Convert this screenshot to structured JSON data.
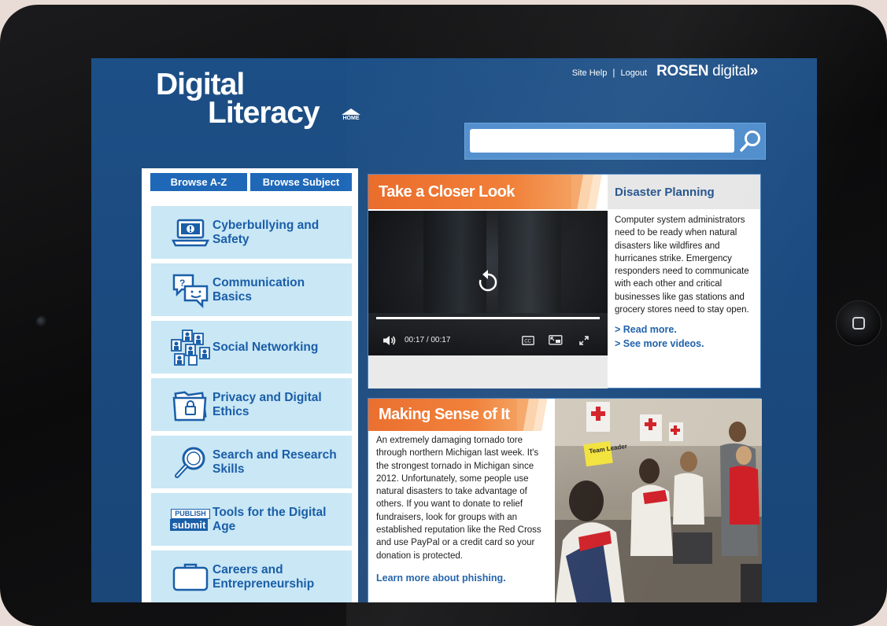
{
  "header": {
    "logo_line1": "Digital",
    "logo_line2": "Literacy",
    "home_label": "HOME",
    "site_help": "Site Help",
    "separator": "|",
    "logout": "Logout",
    "brand_rosen": "ROSEN",
    "brand_digital": "digital",
    "brand_arrows": "»",
    "search": {
      "value": "",
      "placeholder": ""
    }
  },
  "sidebar": {
    "tabs": [
      "Browse A-Z",
      "Browse Subject"
    ],
    "topics": [
      {
        "label": "Cyberbullying and Safety",
        "icon": "laptop-alert-icon"
      },
      {
        "label": "Communication Basics",
        "icon": "chat-bubbles-icon"
      },
      {
        "label": "Social Networking",
        "icon": "network-people-icon"
      },
      {
        "label": "Privacy and Digital Ethics",
        "icon": "folder-lock-icon"
      },
      {
        "label": "Search and Research Skills",
        "icon": "magnifier-icon"
      },
      {
        "label": "Tools for the Digital Age",
        "icon": "publish-submit-icon"
      },
      {
        "label": "Careers and Entrepreneurship",
        "icon": "briefcase-icon"
      }
    ],
    "publish_word": "PUBLISH",
    "submit_word": "submit"
  },
  "closer_look": {
    "heading": "Take a Closer Look",
    "video": {
      "current_time": "00:17",
      "time_separator": "/",
      "duration": "00:17",
      "progress": 1.0
    },
    "side": {
      "title": "Disaster Planning",
      "text": "Computer system administrators need to be ready when natural disasters like wildfires and hurricanes strike. Emergency responders need to communicate with each other and critical businesses like gas stations and grocery stores need to stay open.",
      "read_more": "> Read more.",
      "see_more": "> See more videos."
    }
  },
  "making_sense": {
    "heading": "Making Sense of It",
    "text": "An extremely damaging tornado tore through northern Michigan last week. It's the strongest tornado in Michigan since 2012. Unfortunately, some people use natural disasters to take advantage of others. If you want to donate to relief fundraisers, look for groups with an established reputation like the Red Cross and use PayPal or a credit card so your donation is protected.",
    "link": "Learn more about phishing.",
    "photo_sign": "Team Leader"
  },
  "colors": {
    "screen_blue": "#1c4f86",
    "topic_bg": "#c9e7f5",
    "topic_text": "#1a5ea8",
    "tab_blue": "#1f68b8",
    "orange": "#ea6a28"
  }
}
